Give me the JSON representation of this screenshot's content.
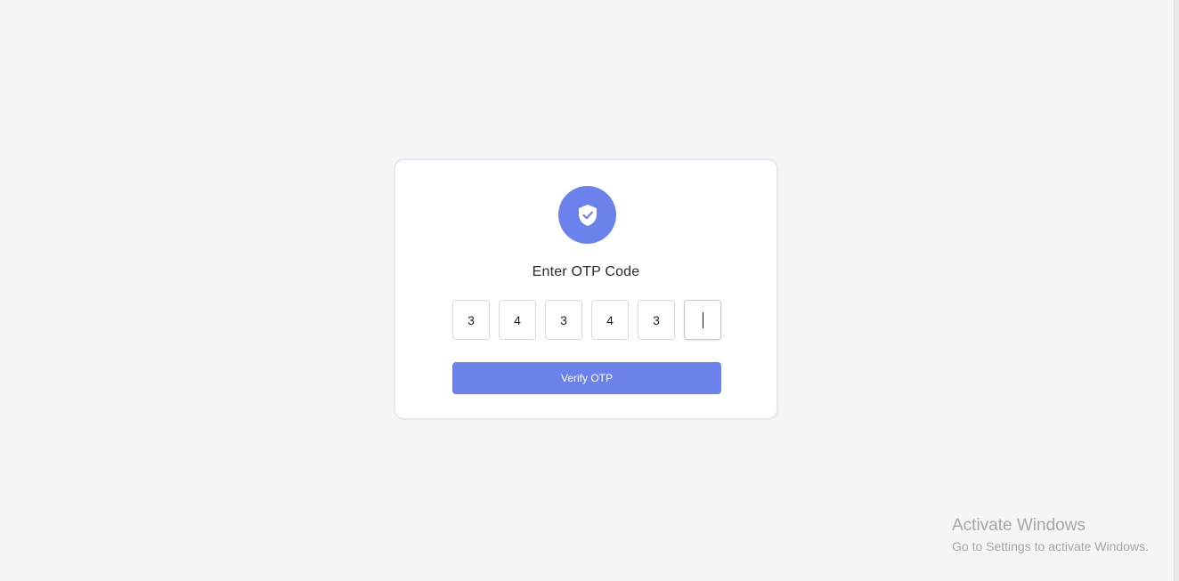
{
  "card": {
    "title": "Enter OTP Code",
    "icon": "shield-check-icon",
    "otp_digits": [
      "3",
      "4",
      "3",
      "4",
      "3",
      ""
    ],
    "active_index": 5,
    "verify_label": "Verify OTP"
  },
  "watermark": {
    "title": "Activate Windows",
    "subtitle": "Go to Settings to activate Windows."
  },
  "colors": {
    "accent": "#6b82ed",
    "background": "#f5f5f7",
    "card": "#ffffff"
  }
}
